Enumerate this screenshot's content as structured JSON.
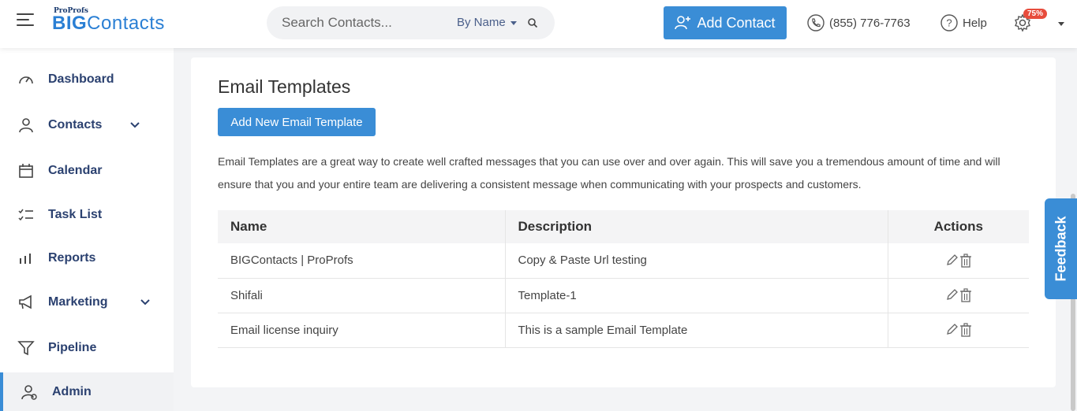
{
  "header": {
    "logo_small": "ProProfs",
    "logo_big": "BIG",
    "logo_rest": "Contacts",
    "search_placeholder": "Search Contacts...",
    "search_by": "By Name",
    "add_contact": "Add Contact",
    "phone": "(855) 776-7763",
    "help": "Help",
    "badge": "75%"
  },
  "sidebar": {
    "items": [
      {
        "label": "Dashboard",
        "icon": "dashboard-icon"
      },
      {
        "label": "Contacts",
        "icon": "user-icon"
      },
      {
        "label": "Calendar",
        "icon": "calendar-icon"
      },
      {
        "label": "Task List",
        "icon": "task-list-icon"
      },
      {
        "label": "Reports",
        "icon": "bar-chart-icon"
      },
      {
        "label": "Marketing",
        "icon": "megaphone-icon"
      },
      {
        "label": "Pipeline",
        "icon": "funnel-icon"
      },
      {
        "label": "Admin",
        "icon": "admin-icon"
      }
    ]
  },
  "main": {
    "title": "Email Templates",
    "add_button": "Add New Email Template",
    "description": "Email Templates are a great way to create well crafted messages that you can use over and over again. This will save you a tremendous amount of time and will ensure that you and your entire team are delivering a consistent message when communicating with your prospects and customers.",
    "table": {
      "headers": [
        "Name",
        "Description",
        "Actions"
      ],
      "rows": [
        {
          "name": "BIGContacts | ProProfs",
          "description": "Copy & Paste Url testing"
        },
        {
          "name": "Shifali",
          "description": "Template-1"
        },
        {
          "name": "Email license inquiry",
          "description": "This is a sample Email Template"
        }
      ]
    }
  },
  "feedback": "Feedback",
  "colors": {
    "accent": "#3a8dd6",
    "nav_text": "#2b4170",
    "badge": "#e74c3c"
  }
}
